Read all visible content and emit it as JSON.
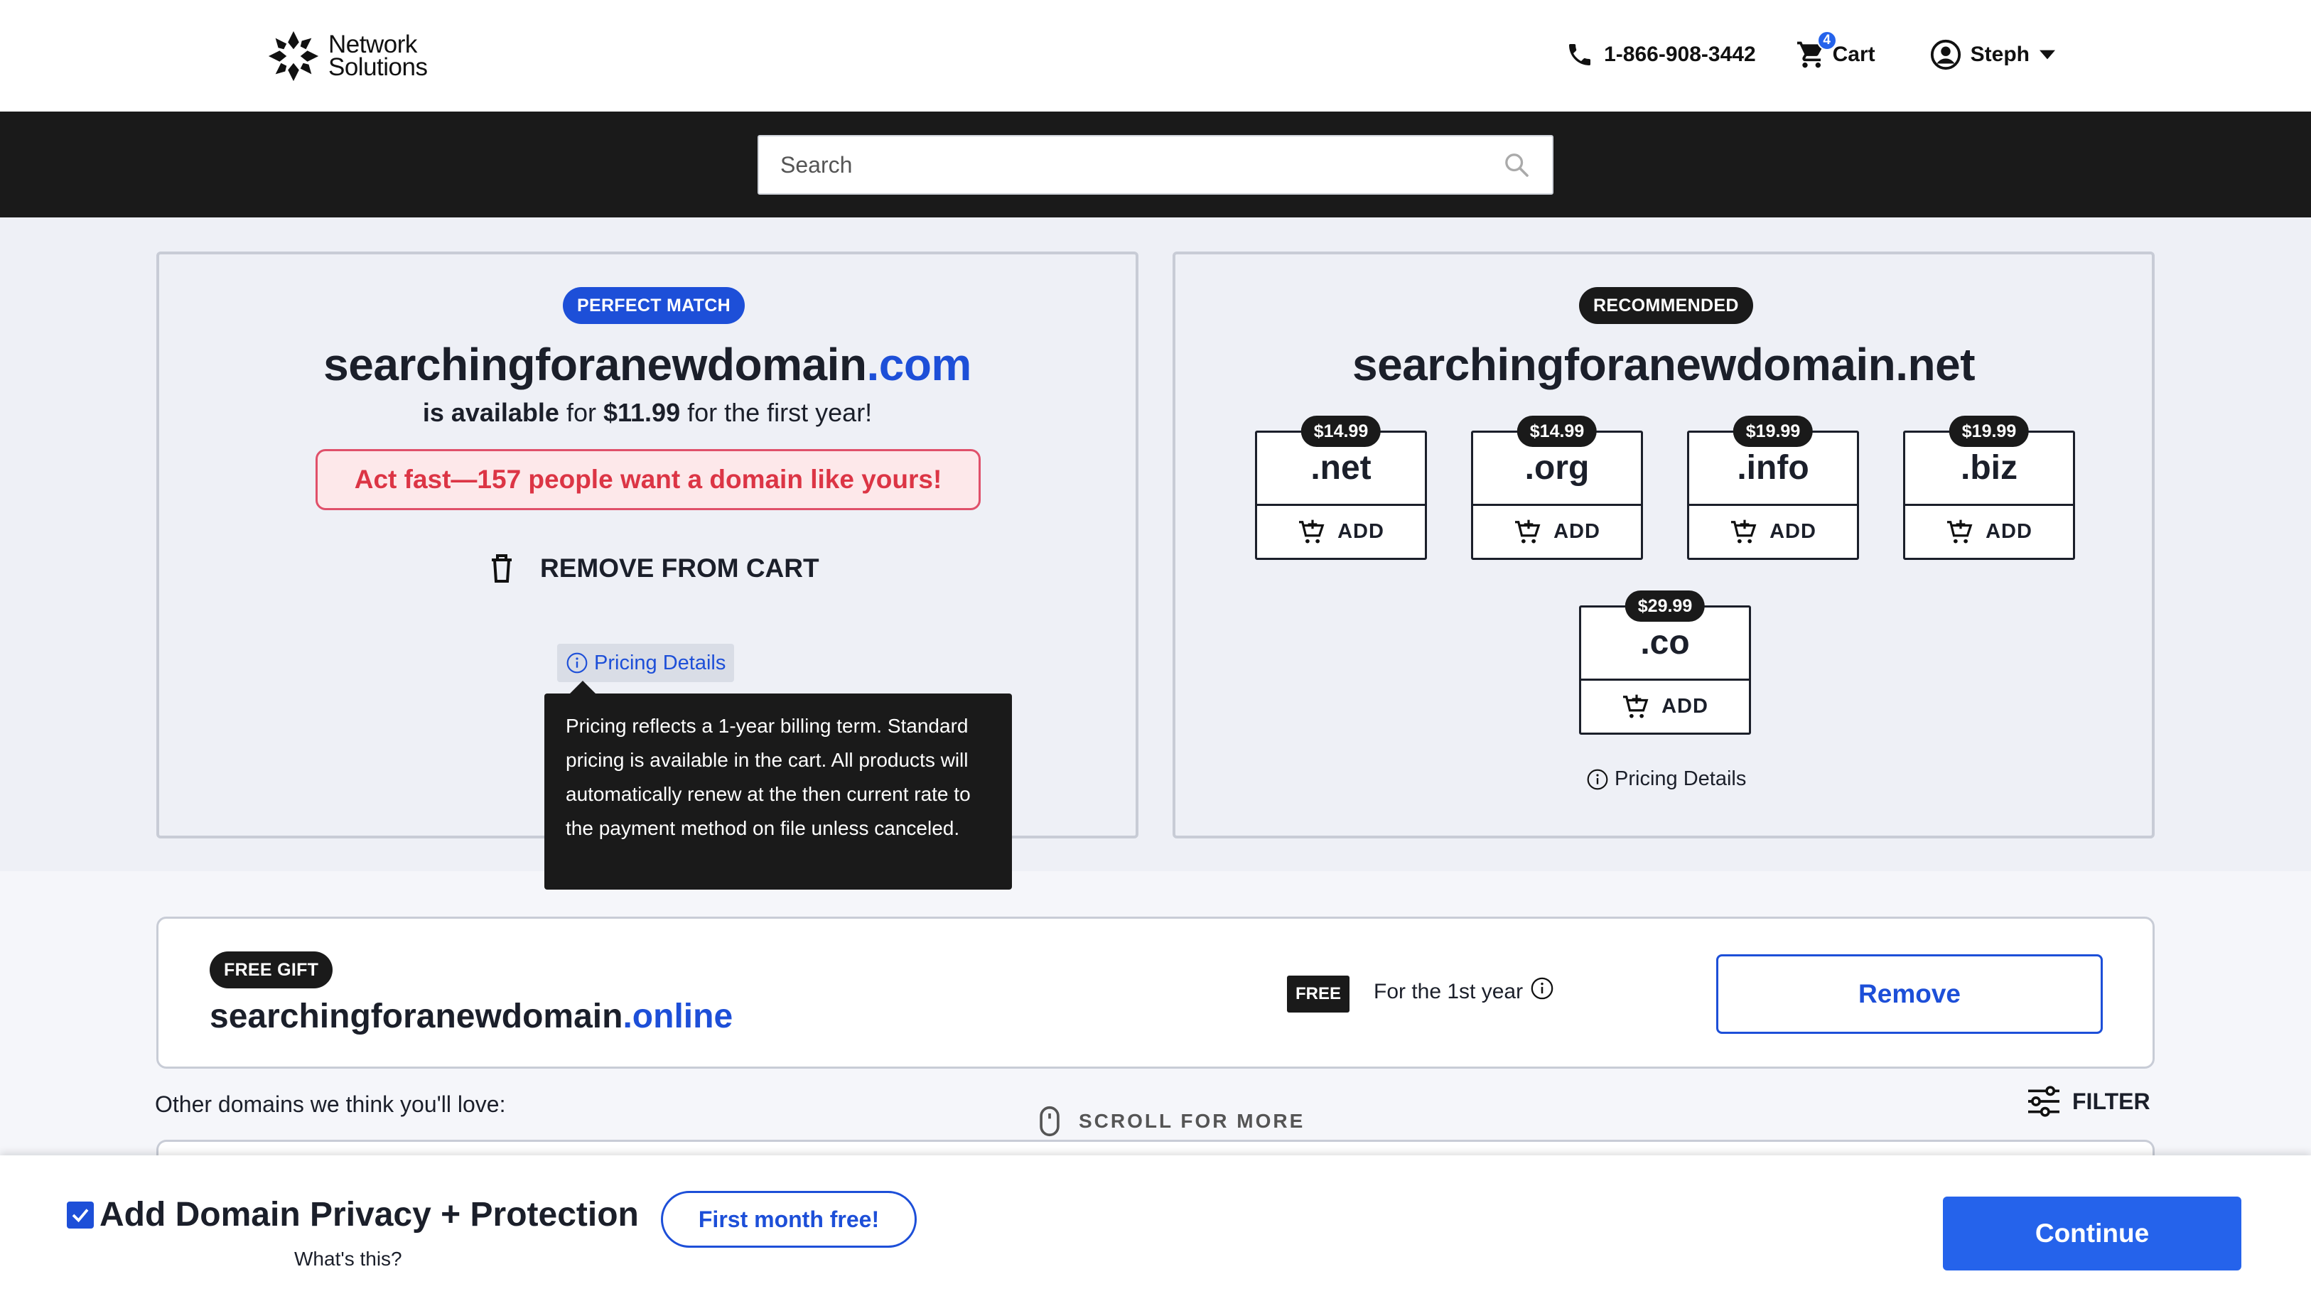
{
  "header": {
    "logo_line1": "Network",
    "logo_line2": "Solutions",
    "phone": "1-866-908-3442",
    "cart_label": "Cart",
    "cart_count": "4",
    "user_name": "Steph"
  },
  "search": {
    "placeholder": "Search"
  },
  "perfect_match": {
    "badge": "PERFECT MATCH",
    "domain_name": "searchingforanewdomain",
    "domain_tld": ".com",
    "avail_prefix": "is available",
    "avail_for": " for ",
    "price": "$11.99",
    "avail_suffix": " for the first year!",
    "urgency": "Act fast—157 people want a domain like yours!",
    "remove_label": "REMOVE FROM CART",
    "pricing_details": "Pricing Details",
    "tooltip": "Pricing reflects a 1-year billing term. Standard pricing is available in the cart. All products will automatically renew at the then current rate to the payment method on file unless canceled."
  },
  "recommended": {
    "badge": "RECOMMENDED",
    "domain": "searchingforanewdomain.net",
    "add_label": "ADD",
    "tlds": [
      {
        "name": ".net",
        "price": "$14.99"
      },
      {
        "name": ".org",
        "price": "$14.99"
      },
      {
        "name": ".info",
        "price": "$19.99"
      },
      {
        "name": ".biz",
        "price": "$19.99"
      },
      {
        "name": ".co",
        "price": "$29.99"
      }
    ],
    "pricing_details": "Pricing Details"
  },
  "gift": {
    "badge": "FREE GIFT",
    "domain_name": "searchingforanewdomain",
    "domain_tld": ".online",
    "free_tag": "FREE",
    "term": "For the 1st year",
    "remove_label": "Remove"
  },
  "other": {
    "label": "Other domains we think you'll love:",
    "scroll": "SCROLL FOR MORE",
    "filter": "FILTER"
  },
  "footer": {
    "privacy_label": "Add Domain Privacy + Protection",
    "privacy_checked": true,
    "whats_this": "What's this?",
    "promo": "First month free!",
    "continue": "Continue"
  },
  "colors": {
    "brand_blue": "#1d4fd8",
    "urgency_red": "#dc3545",
    "dark": "#1a1a1a"
  }
}
